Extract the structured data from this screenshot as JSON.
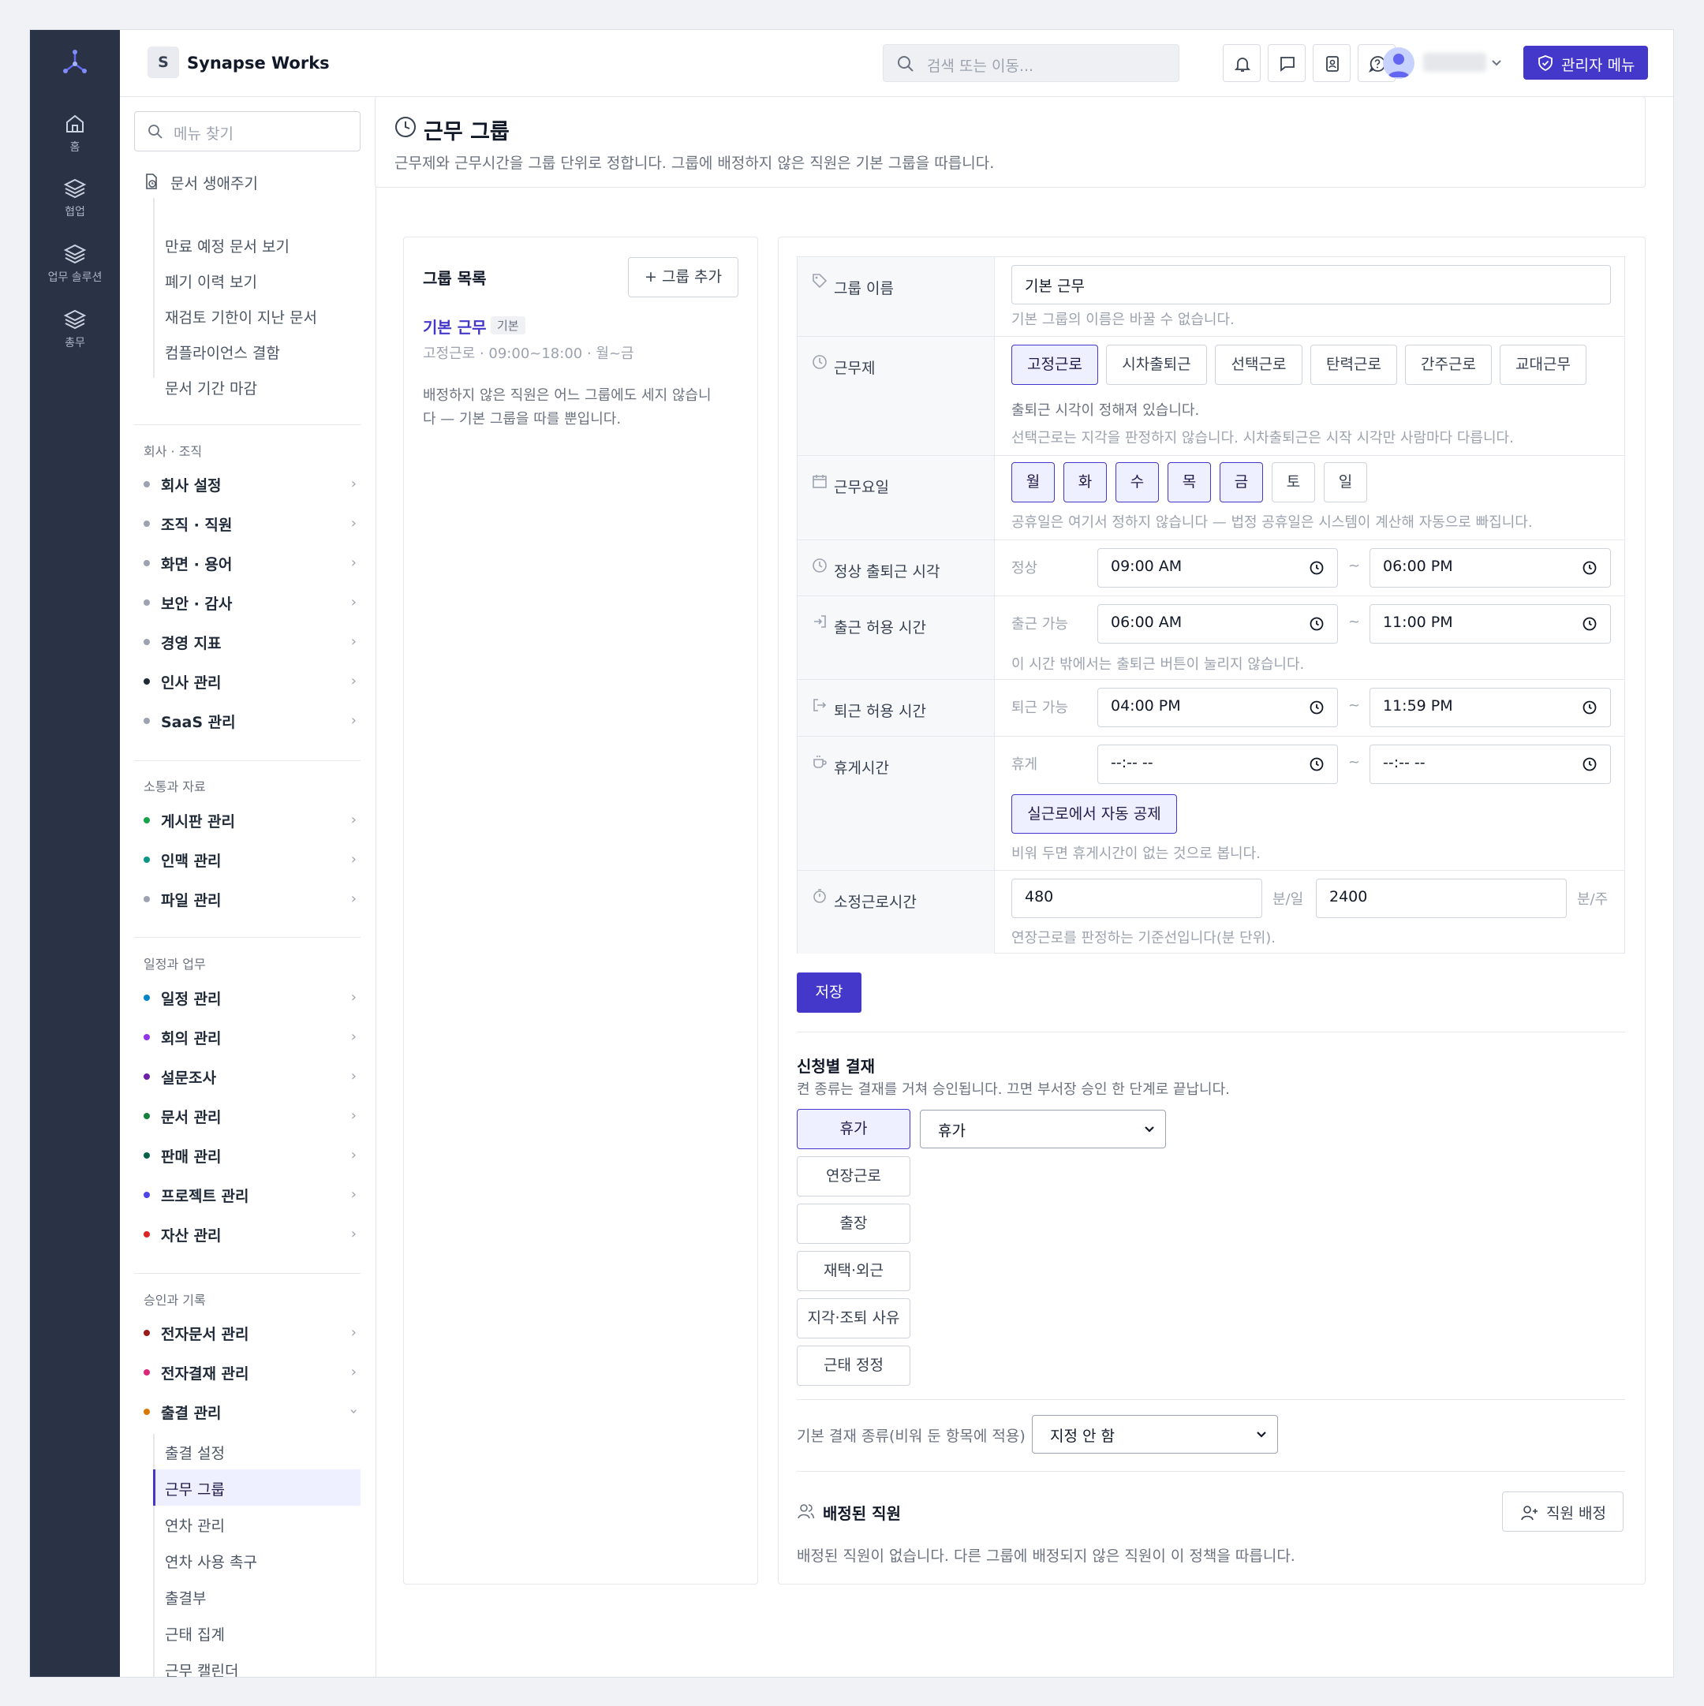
{
  "app": {
    "brand_initial": "S",
    "brand_name": "Synapse Works",
    "search_placeholder": "검색 또는 이동...",
    "admin_menu_label": "관리자 메뉴",
    "accent_color": "#4338ca"
  },
  "rail": {
    "items": [
      {
        "label": "홈",
        "icon": "home-icon"
      },
      {
        "label": "협업",
        "icon": "layers-icon"
      },
      {
        "label": "업무 솔루션",
        "icon": "layers-icon"
      },
      {
        "label": "총무",
        "icon": "layers-icon"
      }
    ]
  },
  "header_icons": [
    "bell-icon",
    "chat-icon",
    "contacts-icon",
    "help-icon",
    "user-avatar-icon",
    "chevron-down-icon"
  ],
  "sidebar": {
    "search_placeholder": "메뉴 찾기",
    "doc_lifecycle": {
      "label": "문서 생애주기",
      "children": [
        "만료 예정 문서 보기",
        "폐기 이력 보기",
        "재검토 기한이 지난 문서",
        "컴플라이언스 결함",
        "문서 기간 마감"
      ]
    },
    "sections": [
      {
        "title": "회사 · 조직",
        "items": [
          {
            "label": "회사 설정",
            "dot": "#9ca3af"
          },
          {
            "label": "조직 · 직원",
            "dot": "#9ca3af"
          },
          {
            "label": "화면 · 용어",
            "dot": "#9ca3af"
          },
          {
            "label": "보안 · 감사",
            "dot": "#9ca3af"
          },
          {
            "label": "경영 지표",
            "dot": "#9ca3af"
          },
          {
            "label": "인사 관리",
            "dot": "#1f2937"
          },
          {
            "label": "SaaS 관리",
            "dot": "#9ca3af"
          }
        ]
      },
      {
        "title": "소통과 자료",
        "items": [
          {
            "label": "게시판 관리",
            "dot": "#16a34a"
          },
          {
            "label": "인맥 관리",
            "dot": "#0d9488"
          },
          {
            "label": "파일 관리",
            "dot": "#9ca3af"
          }
        ]
      },
      {
        "title": "일정과 업무",
        "items": [
          {
            "label": "일정 관리",
            "dot": "#0284c7"
          },
          {
            "label": "회의 관리",
            "dot": "#9333ea"
          },
          {
            "label": "설문조사",
            "dot": "#6b21a8"
          },
          {
            "label": "문서 관리",
            "dot": "#15803d"
          },
          {
            "label": "판매 관리",
            "dot": "#065f46"
          },
          {
            "label": "프로젝트 관리",
            "dot": "#4f46e5"
          },
          {
            "label": "자산 관리",
            "dot": "#dc2626"
          }
        ]
      },
      {
        "title": "승인과 기록",
        "items": [
          {
            "label": "전자문서 관리",
            "dot": "#991b1b"
          },
          {
            "label": "전자결재 관리",
            "dot": "#db2777"
          },
          {
            "label": "출결 관리",
            "dot": "#d97706"
          }
        ]
      }
    ],
    "attendance_children": [
      "출결 설정",
      "근무 그룹",
      "연차 관리",
      "연차 사용 촉구",
      "출결부",
      "근태 집계",
      "근무 캘린더"
    ],
    "active_child": "근무 그룹"
  },
  "page": {
    "title": "근무 그룹",
    "description": "근무제와 근무시간을 그룹 단위로 정합니다. 그룹에 배정하지 않은 직원은 기본 그룹을 따릅니다."
  },
  "group_list": {
    "title": "그룹 목록",
    "add_button": "+ 그룹 추가",
    "group_name": "기본 근무",
    "group_badge": "기본",
    "group_meta": "고정근로 · 09:00~18:00 · 월~금",
    "note_line1": "배정하지 않은 직원은 어느 그룹에도 세지 않습니",
    "note_line2": "다 — 기본 그룹을 따를 뿐입니다."
  },
  "form": {
    "group_name": {
      "label": "그룹 이름",
      "value": "기본 근무",
      "hint": "기본 그룹의 이름은 바꿀 수 없습니다."
    },
    "work_system": {
      "label": "근무제",
      "options": [
        "고정근로",
        "시차출퇴근",
        "선택근로",
        "탄력근로",
        "간주근로",
        "교대근무"
      ],
      "selected": "고정근로",
      "hint1": "출퇴근 시각이 정해져 있습니다.",
      "hint2": "선택근로는 지각을 판정하지 않습니다. 시차출퇴근은 시작 시각만 사람마다 다릅니다."
    },
    "workdays": {
      "label": "근무요일",
      "days": [
        "월",
        "화",
        "수",
        "목",
        "금",
        "토",
        "일"
      ],
      "selected": [
        "월",
        "화",
        "수",
        "목",
        "금"
      ],
      "hint": "공휴일은 여기서 정하지 않습니다 — 법정 공휴일은 시스템이 계산해 자동으로 빠집니다."
    },
    "regular_time": {
      "label": "정상 출퇴근 시각",
      "sub": "정상",
      "from": "09:00 AM",
      "to": "06:00 PM"
    },
    "checkin_window": {
      "label": "출근 허용 시간",
      "sub": "출근 가능",
      "from": "06:00 AM",
      "to": "11:00 PM",
      "hint": "이 시간 밖에서는 출퇴근 버튼이 눌리지 않습니다."
    },
    "checkout_window": {
      "label": "퇴근 허용 시간",
      "sub": "퇴근 가능",
      "from": "04:00 PM",
      "to": "11:59 PM"
    },
    "break_time": {
      "label": "휴게시간",
      "sub": "휴게",
      "from": "--:-- --",
      "to": "--:-- --",
      "toggle": "실근로에서 자동 공제",
      "hint": "비워 두면 휴게시간이 없는 것으로 봅니다."
    },
    "standard_hours": {
      "label": "소정근로시간",
      "per_day": "480",
      "per_day_unit": "분/일",
      "per_week": "2400",
      "per_week_unit": "분/주",
      "hint": "연장근로를 판정하는 기준선입니다(분 단위)."
    },
    "tilde": "~",
    "save_button": "저장"
  },
  "approval": {
    "title": "신청별 결재",
    "description": "켠 종류는 결재를 거쳐 승인됩니다. 끄면 부서장 승인 한 단계로 끝납니다.",
    "types": [
      "휴가",
      "연장근로",
      "출장",
      "재택·외근",
      "지각·조퇴 사유",
      "근태 정정"
    ],
    "active_type": "휴가",
    "active_type_select": "휴가",
    "default_label": "기본 결재 종류(비워 둔 항목에 적용)",
    "default_value": "지정 안 함"
  },
  "assigned": {
    "title": "배정된 직원",
    "button": "직원 배정",
    "empty": "배정된 직원이 없습니다. 다른 그룹에 배정되지 않은 직원이 이 정책을 따릅니다."
  }
}
